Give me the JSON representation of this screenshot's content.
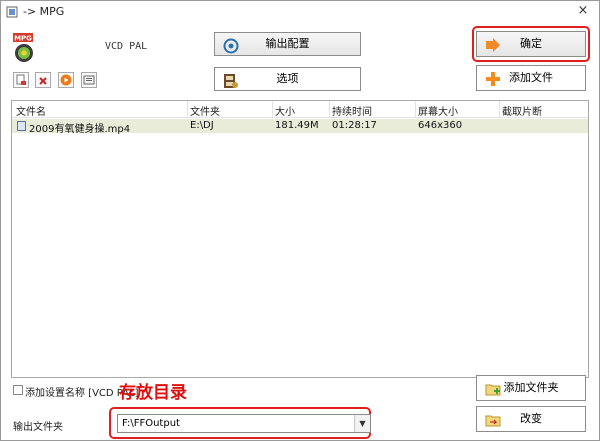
{
  "window": {
    "title": "-> MPG",
    "close_glyph": "×"
  },
  "format": {
    "badge_text": "MPG",
    "profile": "VCD PAL"
  },
  "buttons": {
    "output_config": "输出配置",
    "options": "选项",
    "ok": "确定",
    "add_file": "添加文件",
    "add_folder": "添加文件夹",
    "change": "改变"
  },
  "toolbar_icons": [
    "remove-file-icon",
    "clear-list-icon",
    "play-icon",
    "info-icon"
  ],
  "file_list": {
    "columns": [
      "文件名",
      "文件夹",
      "大小",
      "持续时间",
      "屏幕大小",
      "截取片断"
    ],
    "rows": [
      {
        "name": "2009有氧健身操.mp4",
        "folder": "E:\\DJ",
        "size": "181.49M",
        "duration": "01:28:17",
        "screen_size": "646x360",
        "clip": ""
      }
    ]
  },
  "add_setting_name": {
    "label": "添加设置名称 [VCD PAL]",
    "checked": false
  },
  "annotation": "存放目录",
  "output": {
    "label": "输出文件夹",
    "folder": "F:\\FFOutput"
  },
  "colors": {
    "highlight": "#e02020",
    "row_selected": "#e9ecd9",
    "ok_arrow": "#f08a2a",
    "add_plus": "#f28c1e"
  }
}
